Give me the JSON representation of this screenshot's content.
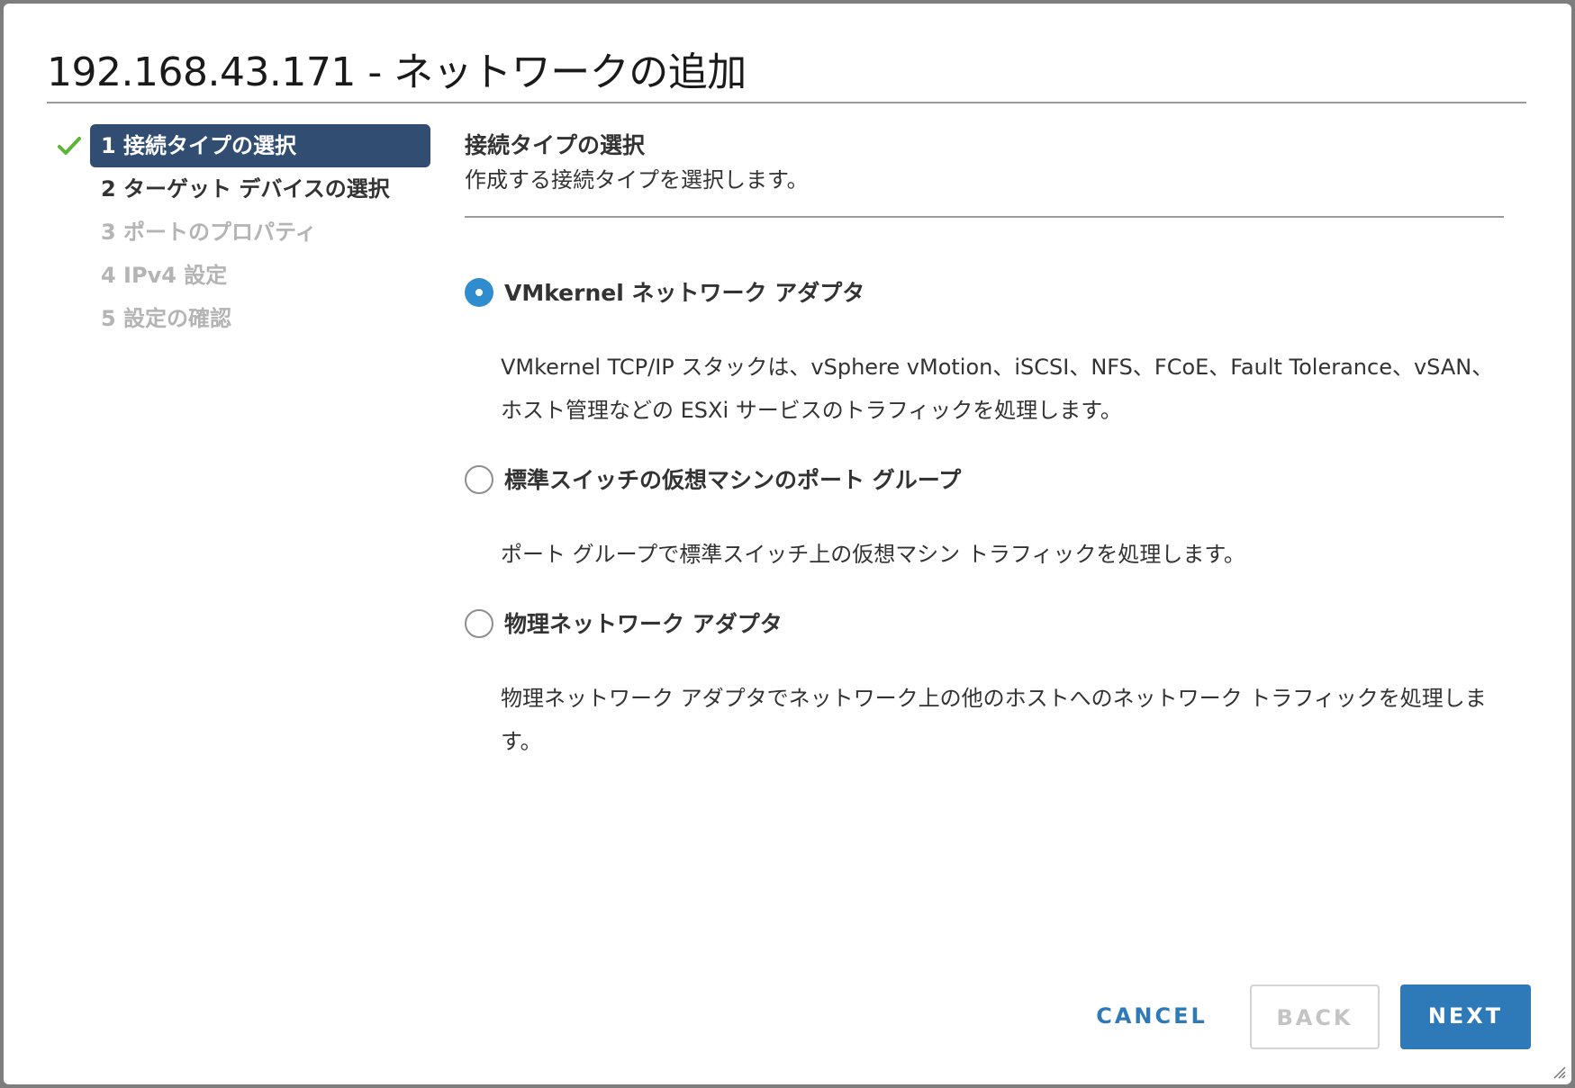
{
  "dialog": {
    "title": "192.168.43.171 - ネットワークの追加"
  },
  "steps": [
    {
      "label": "1 接続タイプの選択",
      "state": "active",
      "completed": true
    },
    {
      "label": "2 ターゲット デバイスの選択",
      "state": "enabled"
    },
    {
      "label": "3 ポートのプロパティ",
      "state": "disabled"
    },
    {
      "label": "4 IPv4 設定",
      "state": "disabled"
    },
    {
      "label": "5 設定の確認",
      "state": "disabled"
    }
  ],
  "content": {
    "heading": "接続タイプの選択",
    "subheading": "作成する接続タイプを選択します。",
    "options": [
      {
        "label": "VMkernel ネットワーク アダプタ",
        "selected": true,
        "description": "VMkernel TCP/IP スタックは、vSphere vMotion、iSCSI、NFS、FCoE、Fault Tolerance、vSAN、ホスト管理などの ESXi サービスのトラフィックを処理します。"
      },
      {
        "label": "標準スイッチの仮想マシンのポート グループ",
        "selected": false,
        "description": "ポート グループで標準スイッチ上の仮想マシン トラフィックを処理します。"
      },
      {
        "label": "物理ネットワーク アダプタ",
        "selected": false,
        "description": "物理ネットワーク アダプタでネットワーク上の他のホストへのネットワーク トラフィックを処理します。"
      }
    ]
  },
  "buttons": {
    "cancel": "CANCEL",
    "back": "BACK",
    "next": "NEXT"
  },
  "colors": {
    "accent": "#2e7ab8",
    "active_step": "#314d72",
    "radio_checked": "#2e8ccf",
    "check_icon": "#5eb535"
  }
}
